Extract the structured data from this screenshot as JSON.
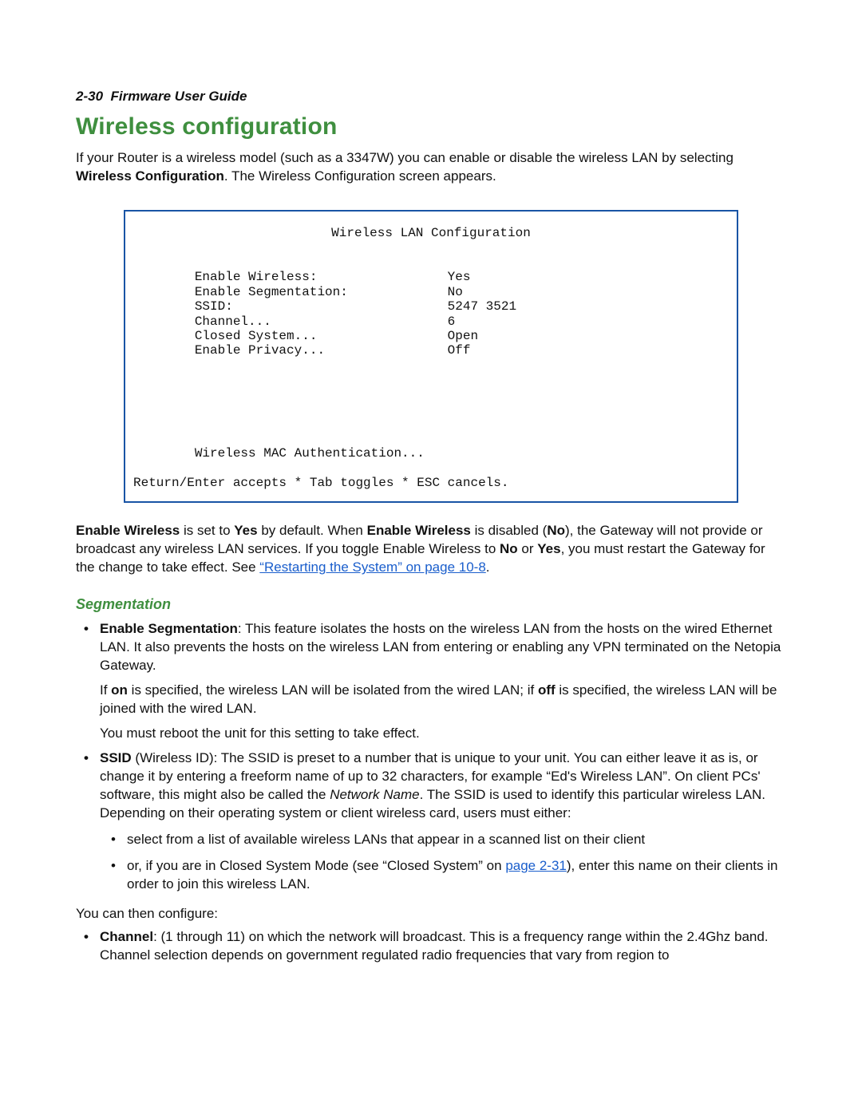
{
  "header": {
    "page_ref": "2-30",
    "doc_title": "Firmware User Guide"
  },
  "h1": "Wireless configuration",
  "intro": {
    "t1": "If your Router is a wireless model (such as a 3347W) you can enable or disable the wireless LAN by selecting ",
    "b1": "Wireless Configuration",
    "t2": ". The Wireless Configuration screen appears."
  },
  "terminal": {
    "title": "Wireless LAN Configuration",
    "rows": [
      {
        "label": "Enable Wireless:",
        "value": "Yes"
      },
      {
        "label": "Enable Segmentation:",
        "value": "No"
      },
      {
        "label": "SSID:",
        "value": "5247 3521"
      },
      {
        "label": "Channel...",
        "value": "6"
      },
      {
        "label": "Closed System...",
        "value": "Open"
      },
      {
        "label": "Enable Privacy...",
        "value": "Off"
      }
    ],
    "mac": "Wireless MAC Authentication...",
    "footer": "Return/Enter accepts * Tab toggles * ESC cancels."
  },
  "enable_para": {
    "b1": "Enable Wireless",
    "t1": " is set to ",
    "b2": "Yes",
    "t2": " by default. When ",
    "b3": "Enable Wireless",
    "t3": " is disabled (",
    "b4": "No",
    "t4": "), the Gateway will not provide or broadcast any wireless LAN services. If you toggle Enable Wireless to ",
    "b5": "No",
    "t5": " or ",
    "b6": "Yes",
    "t6": ", you must restart the Gateway for the change to take effect. See ",
    "link": "“Restarting the System” on page 10-8",
    "t7": "."
  },
  "seg_heading": "Segmentation",
  "li_seg": {
    "b": "Enable Segmentation",
    "t1": ": This feature isolates the hosts on the wireless LAN from the hosts on the wired Ethernet LAN. It also prevents the hosts on the wireless LAN from entering or enabling any VPN terminated on the Netopia Gateway.",
    "p2a": "If ",
    "p2b1": "on",
    "p2b": " is specified, the wireless LAN will be isolated from the wired LAN; if ",
    "p2b2": "off",
    "p2c": " is specified, the wireless LAN will be joined with the wired LAN.",
    "p3": "You must reboot the unit for this setting to take effect."
  },
  "li_ssid": {
    "b": "SSID",
    "t1": " (Wireless ID): The SSID is preset to a number that is unique to your unit. You can either leave it as is, or change it by entering a freeform name of up to 32 characters, for example “Ed's Wireless LAN”. On client PCs' software, this might also be called the ",
    "i": "Network Name",
    "t2": ". The SSID is used to identify this particular wireless LAN. Depending on their operating system or client wireless card, users must either:",
    "sub1": "select from a list of available wireless LANs that appear in a scanned list on their client",
    "sub2a": "or, if you are in Closed System Mode (see “Closed System” on ",
    "sub2link": "page 2-31",
    "sub2b": "), enter this name on their clients in order to join this wireless LAN."
  },
  "then_configure": "You can then configure:",
  "li_channel": {
    "b": "Channel",
    "t": ": (1 through 11) on which the network will broadcast. This is a frequency range within the 2.4Ghz band. Channel selection depends on government regulated radio frequencies that vary from region to"
  }
}
